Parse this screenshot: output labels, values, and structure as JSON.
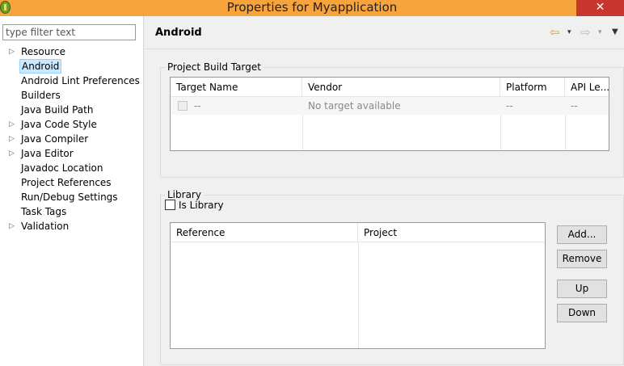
{
  "window": {
    "title": "Properties for Myapplication",
    "close_glyph": "✕"
  },
  "filter": {
    "placeholder": "type filter text"
  },
  "tree": [
    {
      "label": "Resource",
      "expandable": true,
      "selected": false
    },
    {
      "label": "Android",
      "expandable": false,
      "selected": true
    },
    {
      "label": "Android Lint Preferences",
      "expandable": false,
      "selected": false
    },
    {
      "label": "Builders",
      "expandable": false,
      "selected": false
    },
    {
      "label": "Java Build Path",
      "expandable": false,
      "selected": false
    },
    {
      "label": "Java Code Style",
      "expandable": true,
      "selected": false
    },
    {
      "label": "Java Compiler",
      "expandable": true,
      "selected": false
    },
    {
      "label": "Java Editor",
      "expandable": true,
      "selected": false
    },
    {
      "label": "Javadoc Location",
      "expandable": false,
      "selected": false
    },
    {
      "label": "Project References",
      "expandable": false,
      "selected": false
    },
    {
      "label": "Run/Debug Settings",
      "expandable": false,
      "selected": false
    },
    {
      "label": "Task Tags",
      "expandable": false,
      "selected": false
    },
    {
      "label": "Validation",
      "expandable": true,
      "selected": false
    }
  ],
  "page": {
    "title": "Android"
  },
  "nav": {
    "back": "⇦",
    "forward": "⇨",
    "dropdown": "▾",
    "menu": "▼"
  },
  "build_target": {
    "legend": "Project Build Target",
    "columns": [
      "Target Name",
      "Vendor",
      "Platform",
      "API Le..."
    ],
    "row": {
      "name": "--",
      "vendor": "No target available",
      "platform": "--",
      "api": "--"
    }
  },
  "library": {
    "legend": "Library",
    "is_library_label": "Is Library",
    "is_library_checked": false,
    "columns": [
      "Reference",
      "Project"
    ],
    "buttons": {
      "add": "Add...",
      "remove": "Remove",
      "up": "Up",
      "down": "Down"
    }
  },
  "colors": {
    "titlebar": "#f8a43c",
    "close": "#c7372f",
    "selection": "#cce8ff"
  },
  "icons": {
    "app": "android-adt-icon",
    "back": "back-arrow-icon",
    "forward": "forward-arrow-icon",
    "menu": "view-menu-icon"
  }
}
